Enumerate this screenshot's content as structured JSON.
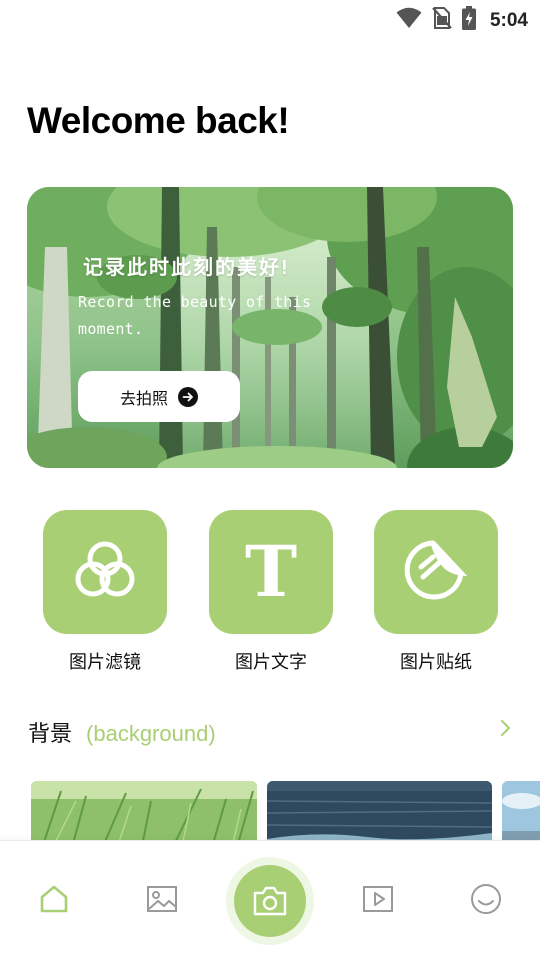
{
  "status_bar": {
    "time": "5:04",
    "icons": [
      "wifi-icon",
      "no-sim-icon",
      "battery-charging-icon"
    ]
  },
  "header": {
    "title": "Welcome back!"
  },
  "hero": {
    "title": "记录此时此刻的美好!",
    "subtitle": "Record the beauty of this moment.",
    "button_label": "去拍照",
    "button_icon": "arrow-right-circle-icon"
  },
  "features": [
    {
      "label": "图片滤镜",
      "icon": "filter-circles-icon"
    },
    {
      "label": "图片文字",
      "icon": "text-t-icon"
    },
    {
      "label": "图片贴纸",
      "icon": "sticker-icon"
    }
  ],
  "background_section": {
    "title": "背景",
    "subtitle": "(background)",
    "more_icon": "chevron-right-icon",
    "thumbnails": [
      "grass",
      "ocean",
      "sky-sea"
    ]
  },
  "bottom_nav": {
    "items": [
      "home-icon",
      "gallery-icon",
      "camera-icon",
      "video-icon",
      "smile-icon"
    ],
    "active": "home-icon"
  },
  "colors": {
    "accent": "#a9cf74",
    "accent_light": "#eef6e4",
    "text": "#111111",
    "nav_icon": "#9a9a9a"
  }
}
